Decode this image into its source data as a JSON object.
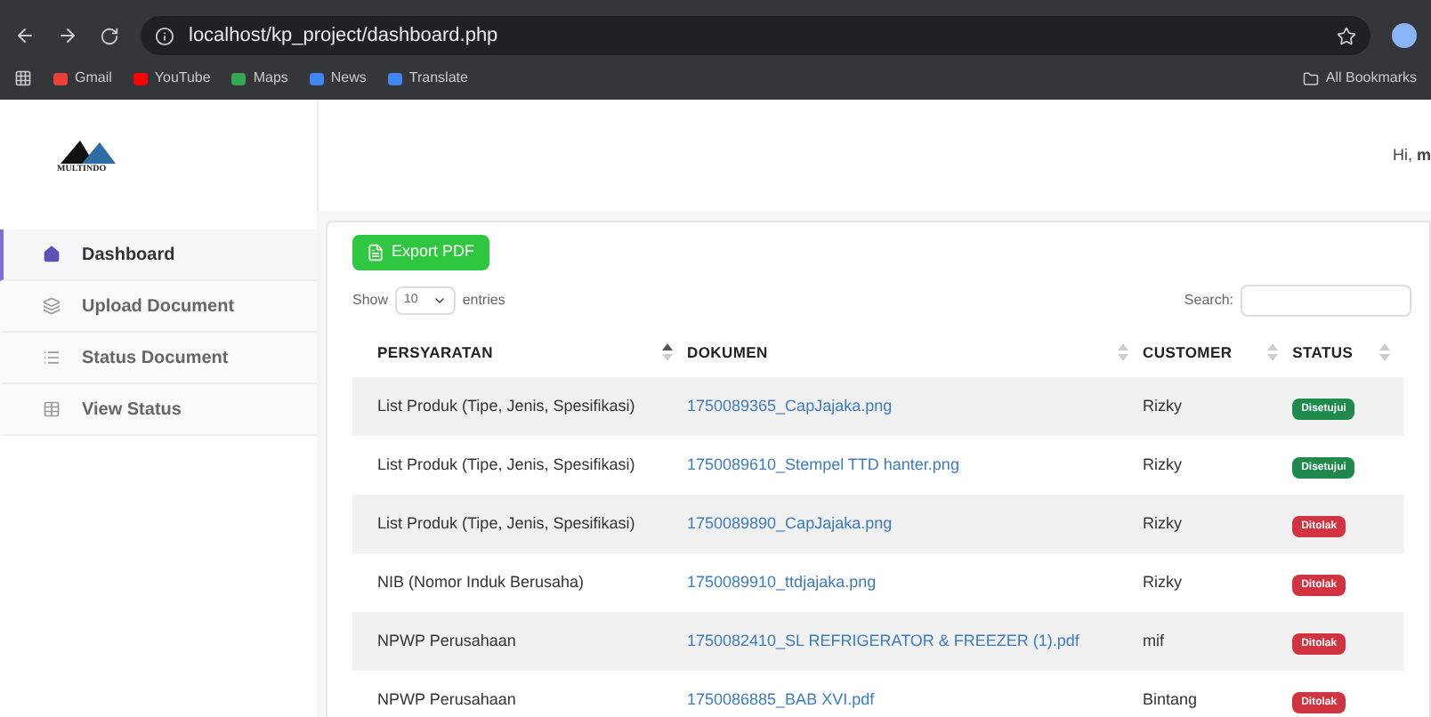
{
  "browser": {
    "url": "localhost/kp_project/dashboard.php",
    "bookmarks": [
      "Gmail",
      "YouTube",
      "Maps",
      "News",
      "Translate"
    ],
    "all_bookmarks": "All Bookmarks"
  },
  "header": {
    "greeting": "Hi, **m**"
  },
  "logo": {
    "text": "MULTINDO"
  },
  "sidebar": {
    "items": [
      {
        "label": "Dashboard",
        "selected": true
      },
      {
        "label": "Upload Document",
        "selected": false
      },
      {
        "label": "Status Document",
        "selected": false
      },
      {
        "label": "View Status",
        "selected": false
      }
    ]
  },
  "toolbar": {
    "export_button": "Export PDF",
    "show_label": "Show",
    "entries_value": "10",
    "entries_label": "entries",
    "search_label": "Search:"
  },
  "table": {
    "columns": [
      {
        "label": "PERSYARATAN",
        "sorted": true
      },
      {
        "label": "DOKUMEN",
        "sorted": false
      },
      {
        "label": "CUSTOMER",
        "sorted": false
      },
      {
        "label": "STATUS",
        "sorted": false
      }
    ],
    "rows": [
      {
        "persyaratan": "List Produk (Tipe, Jenis, Spesifikasi)",
        "dokumen": "1750089365_CapJajaka.png",
        "customer": "Rizky",
        "status": "Disetujui",
        "kind": "approved"
      },
      {
        "persyaratan": "List Produk (Tipe, Jenis, Spesifikasi)",
        "dokumen": "1750089610_Stempel TTD hanter.png",
        "customer": "Rizky",
        "status": "Disetujui",
        "kind": "approved"
      },
      {
        "persyaratan": "List Produk (Tipe, Jenis, Spesifikasi)",
        "dokumen": "1750089890_CapJajaka.png",
        "customer": "Rizky",
        "status": "Ditolak",
        "kind": "rejected"
      },
      {
        "persyaratan": "NIB (Nomor Induk Berusaha)",
        "dokumen": "1750089910_ttdjajaka.png",
        "customer": "Rizky",
        "status": "Ditolak",
        "kind": "rejected"
      },
      {
        "persyaratan": "NPWP Perusahaan",
        "dokumen": "1750082410_SL REFRIGERATOR & FREEZER (1).pdf",
        "customer": "mif",
        "status": "Ditolak",
        "kind": "rejected"
      },
      {
        "persyaratan": "NPWP Perusahaan",
        "dokumen": "1750086885_BAB XVI.pdf",
        "customer": "Bintang",
        "status": "Ditolak",
        "kind": "rejected"
      }
    ]
  }
}
